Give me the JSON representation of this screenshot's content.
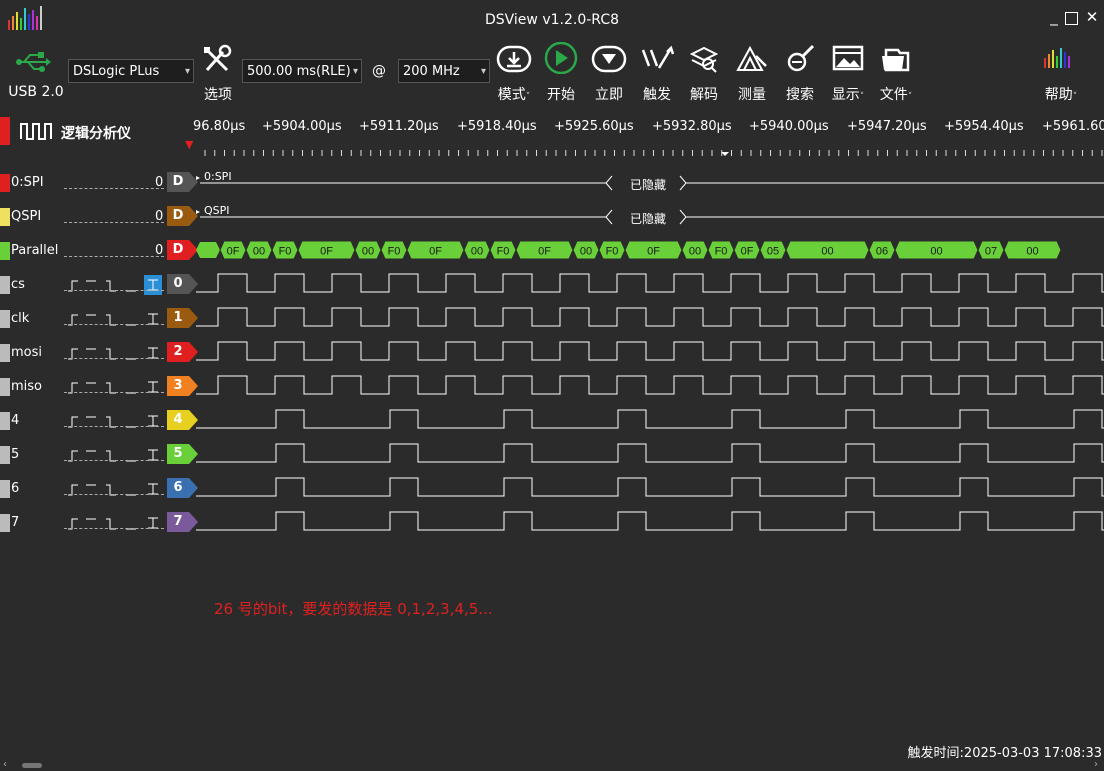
{
  "window": {
    "title": "DSView v1.2.0-RC8"
  },
  "toolbar": {
    "usb_label": "USB 2.0",
    "device": "DSLogic PLus",
    "options_label": "选项",
    "sample_time": "500.00 ms(RLE)",
    "at": "@",
    "sample_rate": "200 MHz",
    "buttons": [
      {
        "label": "模式",
        "icon": "download-icon",
        "chevron": true
      },
      {
        "label": "开始",
        "icon": "play-icon",
        "chevron": false
      },
      {
        "label": "立即",
        "icon": "instant-icon",
        "chevron": false
      },
      {
        "label": "触发",
        "icon": "trigger-icon",
        "chevron": false
      },
      {
        "label": "解码",
        "icon": "decode-icon",
        "chevron": false
      },
      {
        "label": "测量",
        "icon": "measure-icon",
        "chevron": false
      },
      {
        "label": "搜索",
        "icon": "search-icon",
        "chevron": false
      },
      {
        "label": "显示",
        "icon": "display-icon",
        "chevron": true
      },
      {
        "label": "文件",
        "icon": "file-icon",
        "chevron": true
      },
      {
        "label": "帮助",
        "icon": "help-icon",
        "chevron": true
      }
    ]
  },
  "header": {
    "mode_label": "逻辑分析仪",
    "ticks": [
      "96.80μs",
      "+5904.00μs",
      "+5911.20μs",
      "+5918.40μs",
      "+5925.60μs",
      "+5932.80μs",
      "+5940.00μs",
      "+5947.20μs",
      "+5954.40μs",
      "+5961.60"
    ]
  },
  "decoders": [
    {
      "name": "0:SPI",
      "color": "#e02020",
      "count": "0",
      "tag": "D",
      "tag_color": "#555555",
      "label": "0:SPI",
      "hidden_text": "已隐藏"
    },
    {
      "name": "QSPI",
      "color": "#f0e060",
      "count": "0",
      "tag": "D",
      "tag_color": "#9a5a10",
      "label": "QSPI",
      "hidden_text": "已隐藏"
    },
    {
      "name": "Parallel",
      "color": "#6ad03a",
      "count": "0",
      "tag": "D",
      "tag_color": "#e02020",
      "values": [
        "0F",
        "00",
        "F0",
        "0F",
        "00",
        "F0",
        "0F",
        "00",
        "F0",
        "0F",
        "00",
        "F0",
        "0F",
        "00",
        "F0",
        "0F",
        "05",
        "00",
        "06",
        "00",
        "07",
        "00"
      ]
    }
  ],
  "channels": [
    {
      "name": "cs",
      "index": "0",
      "color": "#bbbbbb",
      "tag_color": "#555555",
      "trigger": "_⎺_⎺ ⎺⎺_ _ ⌶"
    },
    {
      "name": "clk",
      "index": "1",
      "color": "#bbbbbb",
      "tag_color": "#9a5a10",
      "trigger": "_⎺_⎺ ⎺⎺_ _ ⌶"
    },
    {
      "name": "mosi",
      "index": "2",
      "color": "#bbbbbb",
      "tag_color": "#e02020",
      "trigger": "_⎺_⎺ ⎺⎺_ _ ⌶"
    },
    {
      "name": "miso",
      "index": "3",
      "color": "#bbbbbb",
      "tag_color": "#f08020",
      "trigger": "_⎺_⎺ ⎺⎺_ _ ⌶"
    },
    {
      "name": "4",
      "index": "4",
      "color": "#bbbbbb",
      "tag_color": "#e8d020",
      "trigger": "_⎺_⎺ ⎺⎺_ _ ⌶"
    },
    {
      "name": "5",
      "index": "5",
      "color": "#bbbbbb",
      "tag_color": "#6ad03a",
      "trigger": "_⎺_⎺ ⎺⎺_ _ ⌶"
    },
    {
      "name": "6",
      "index": "6",
      "color": "#bbbbbb",
      "tag_color": "#3a6fb0",
      "trigger": "_⎺_⎺ ⎺⎺_ _ ⌶"
    },
    {
      "name": "7",
      "index": "7",
      "color": "#bbbbbb",
      "tag_color": "#7a5a9a",
      "trigger": "_⎺_⎺ ⎺⎺_ _ ⌶"
    }
  ],
  "note": "26 号的bit，要发的数据是 0,1,2,3,4,5...",
  "status": {
    "trigger_time": "触发时间:2025-03-03 17:08:33"
  }
}
